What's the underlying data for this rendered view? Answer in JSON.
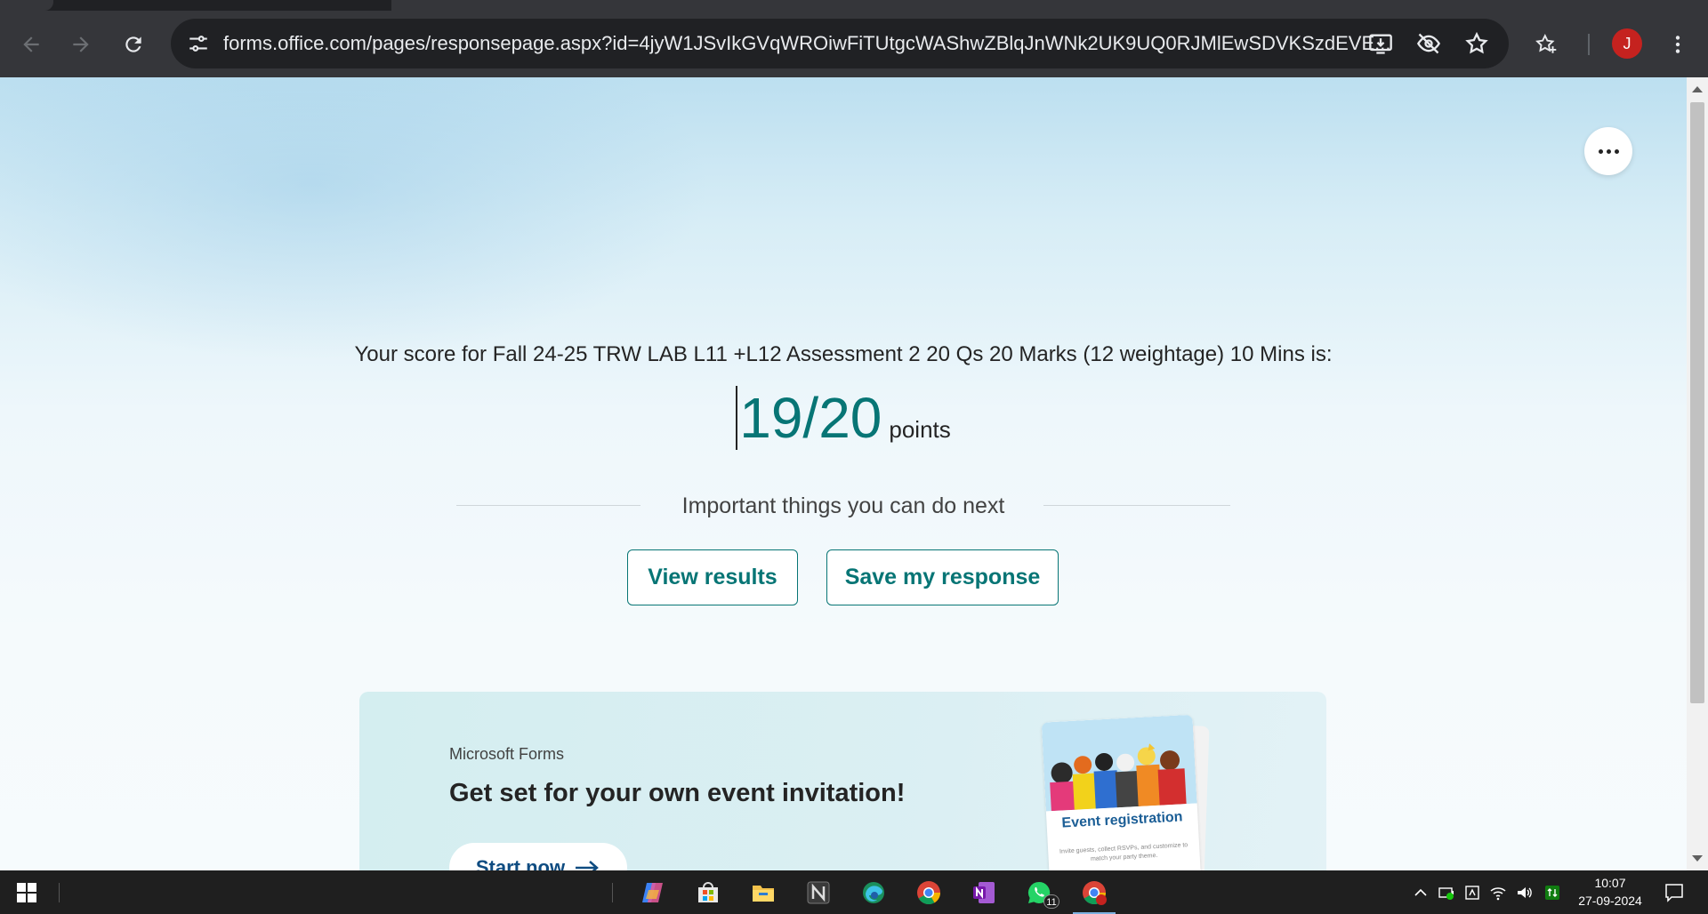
{
  "browser": {
    "url": "forms.office.com/pages/responsepage.aspx?id=4jyW1JSvIkGVqWROiwFiTUtgcWAShwZBlqJnWNk2UK9UQ0RJMlEwSDVKSzdEVE...",
    "profile_initial": "J",
    "icons": [
      "back-icon",
      "forward-icon",
      "reload-icon",
      "site-info-icon",
      "install-app-icon",
      "eye-off-icon",
      "bookmark-star-icon",
      "favorites-icon",
      "kebab-menu-icon"
    ]
  },
  "page": {
    "score_line": "Your score for Fall 24-25 TRW LAB L11 +L12 Assessment 2 20 Qs 20 Marks (12 weightage) 10 Mins is:",
    "score_value": "19/20",
    "score_unit": "points",
    "next_heading": "Important things you can do next",
    "view_results": "View results",
    "save_response": "Save my response"
  },
  "promo": {
    "brand": "Microsoft Forms",
    "title": "Get set for your own event invitation!",
    "start": "Start now",
    "card_title": "Event registration",
    "card_desc": "Invite guests, collect RSVPs, and customize to match your party theme."
  },
  "taskbar": {
    "apps": [
      "copilot-icon",
      "store-icon",
      "file-explorer-icon",
      "notion-icon",
      "edge-icon",
      "chrome-icon",
      "onenote-icon",
      "whatsapp-icon",
      "chrome-profile-icon"
    ],
    "whatsapp_badge": "11",
    "time": "10:07",
    "date": "27-09-2024"
  },
  "colors": {
    "accent": "#077575",
    "promo_text": "#0f4c81",
    "avatar": "#c5221f"
  }
}
